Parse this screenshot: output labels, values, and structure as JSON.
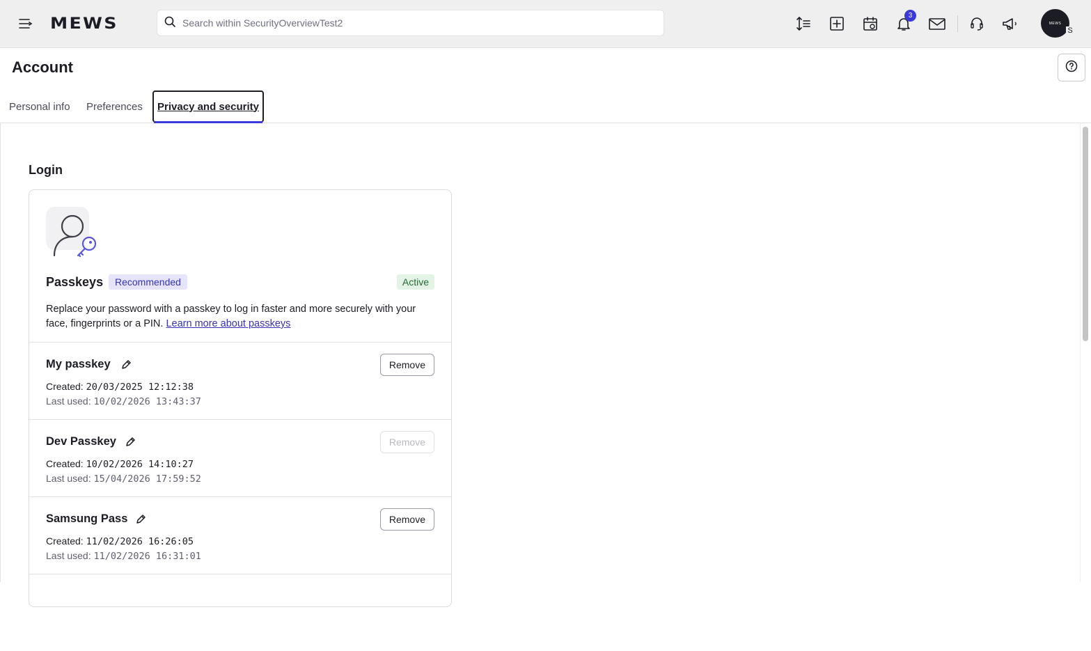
{
  "topbar": {
    "logo": "MEWS",
    "search_placeholder": "Search within SecurityOverviewTest2",
    "notifications_count": "3",
    "avatar_text": "MEWS",
    "avatar_initial": "S",
    "icons": [
      "menu-collapse-icon",
      "search-icon",
      "sort-icon",
      "add-icon",
      "calendar-view-icon",
      "bell-icon",
      "mail-icon",
      "headset-icon",
      "megaphone-icon"
    ]
  },
  "header": {
    "title": "Account",
    "tabs": [
      {
        "label": "Personal info",
        "active": false
      },
      {
        "label": "Preferences",
        "active": false
      },
      {
        "label": "Privacy and security",
        "active": true
      }
    ]
  },
  "login": {
    "section_title": "Login",
    "passkeys": {
      "title": "Passkeys",
      "recommended_label": "Recommended",
      "status_label": "Active",
      "description": "Replace your password with a passkey to log in faster and more securely with your face, fingerprints or a PIN.",
      "learn_more_label": "Learn more about passkeys",
      "items": [
        {
          "name": "My passkey",
          "created_label": "Created:",
          "created": "20/03/2025 12:12:38",
          "last_used_label": "Last used:",
          "last_used": "10/02/2026 13:43:37",
          "remove_label": "Remove",
          "remove_enabled": true
        },
        {
          "name": "Dev Passkey",
          "created_label": "Created:",
          "created": "10/02/2026 14:10:27",
          "last_used_label": "Last used:",
          "last_used": "15/04/2026 17:59:52",
          "remove_label": "Remove",
          "remove_enabled": false
        },
        {
          "name": "Samsung Pass",
          "created_label": "Created:",
          "created": "11/02/2026 16:26:05",
          "last_used_label": "Last used:",
          "last_used": "11/02/2026 16:31:01",
          "remove_label": "Remove",
          "remove_enabled": true
        }
      ]
    }
  },
  "colors": {
    "accent": "#3a3ad8",
    "active_bg": "#e3f4e6",
    "recommended_bg": "#e5e4fb"
  }
}
